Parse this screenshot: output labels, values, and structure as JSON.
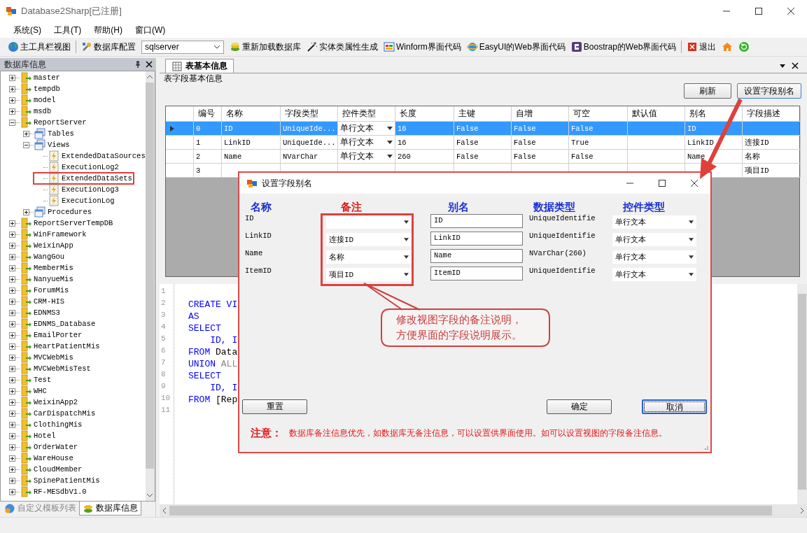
{
  "window": {
    "title": "Database2Sharp[已注册]"
  },
  "menu": [
    "系统(S)",
    "工具(T)",
    "帮助(H)",
    "窗口(W)"
  ],
  "toolbar": [
    {
      "kind": "button",
      "label": "主工具栏视图"
    },
    {
      "kind": "separator"
    },
    {
      "kind": "button",
      "label": "数据库配置"
    },
    {
      "kind": "combo",
      "value": "sqlserver"
    },
    {
      "kind": "button",
      "label": "重新加载数据库"
    },
    {
      "kind": "button",
      "label": "实体类属性生成"
    },
    {
      "kind": "button",
      "label": "Winform界面代码"
    },
    {
      "kind": "button",
      "label": "EasyUI的Web界面代码"
    },
    {
      "kind": "button",
      "label": "Boostrap的Web界面代码"
    },
    {
      "kind": "separator"
    },
    {
      "kind": "button",
      "label": "退出"
    },
    {
      "kind": "icon"
    },
    {
      "kind": "icon"
    }
  ],
  "tree": {
    "title": "数据库信息",
    "items": [
      {
        "label": "master",
        "kind": "database",
        "expanded": false
      },
      {
        "label": "tempdb",
        "kind": "database",
        "expanded": false
      },
      {
        "label": "model",
        "kind": "database",
        "expanded": false
      },
      {
        "label": "msdb",
        "kind": "database",
        "expanded": false
      },
      {
        "label": "ReportServer",
        "kind": "database",
        "expanded": true,
        "children": [
          {
            "label": "Tables",
            "kind": "folder",
            "expanded": false
          },
          {
            "label": "Views",
            "kind": "folder",
            "expanded": true,
            "children": [
              {
                "label": "ExtendedDataSources",
                "kind": "view",
                "marked": false
              },
              {
                "label": "ExecutionLog2",
                "kind": "view",
                "marked": false
              },
              {
                "label": "ExtendedDataSets",
                "kind": "view",
                "marked": true
              },
              {
                "label": "ExecutionLog3",
                "kind": "view",
                "marked": false
              },
              {
                "label": "ExecutionLog",
                "kind": "view",
                "marked": false
              }
            ]
          },
          {
            "label": "Procedures",
            "kind": "folder",
            "expanded": false
          }
        ]
      },
      {
        "label": "ReportServerTempDB",
        "kind": "database",
        "expanded": false
      },
      {
        "label": "WinFramework",
        "kind": "database",
        "expanded": false
      },
      {
        "label": "WeixinApp",
        "kind": "database",
        "expanded": false
      },
      {
        "label": "WangGou",
        "kind": "database",
        "expanded": false
      },
      {
        "label": "MemberMis",
        "kind": "database",
        "expanded": false
      },
      {
        "label": "NanyueMis",
        "kind": "database",
        "expanded": false
      },
      {
        "label": "ForumMis",
        "kind": "database",
        "expanded": false
      },
      {
        "label": "CRM-HIS",
        "kind": "database",
        "expanded": false
      },
      {
        "label": "EDNMS3",
        "kind": "database",
        "expanded": false
      },
      {
        "label": "EDNMS_Database",
        "kind": "database",
        "expanded": false
      },
      {
        "label": "EmailPorter",
        "kind": "database",
        "expanded": false
      },
      {
        "label": "HeartPatientMis",
        "kind": "database",
        "expanded": false
      },
      {
        "label": "MVCWebMis",
        "kind": "database",
        "expanded": false
      },
      {
        "label": "MVCWebMisTest",
        "kind": "database",
        "expanded": false
      },
      {
        "label": "Test",
        "kind": "database",
        "expanded": false
      },
      {
        "label": "WHC",
        "kind": "database",
        "expanded": false
      },
      {
        "label": "WeixinApp2",
        "kind": "database",
        "expanded": false
      },
      {
        "label": "CarDispatchMis",
        "kind": "database",
        "expanded": false
      },
      {
        "label": "ClothingMis",
        "kind": "database",
        "expanded": false
      },
      {
        "label": "Hotel",
        "kind": "database",
        "expanded": false
      },
      {
        "label": "OrderWater",
        "kind": "database",
        "expanded": false
      },
      {
        "label": "WareHouse",
        "kind": "database",
        "expanded": false
      },
      {
        "label": "CloudMember",
        "kind": "database",
        "expanded": false
      },
      {
        "label": "SpinePatientMis",
        "kind": "database",
        "expanded": false
      },
      {
        "label": "RF-MESdbV1.0",
        "kind": "database",
        "expanded": false
      }
    ]
  },
  "panel_tabs": [
    {
      "label": "自定义模板列表",
      "selected": false
    },
    {
      "label": "数据库信息",
      "selected": true
    }
  ],
  "document_tab": {
    "label": "表基本信息"
  },
  "section_label": "表字段基本信息",
  "buttons": [
    "刷新",
    "设置字段别名"
  ],
  "table": {
    "columns": [
      {
        "label": "编号",
        "kind": "text"
      },
      {
        "label": "名称",
        "kind": "text"
      },
      {
        "label": "字段类型",
        "kind": "text"
      },
      {
        "label": "控件类型",
        "kind": "combo"
      },
      {
        "label": "长度",
        "kind": "text"
      },
      {
        "label": "主键",
        "kind": "text"
      },
      {
        "label": "自增",
        "kind": "text"
      },
      {
        "label": "可空",
        "kind": "text"
      },
      {
        "label": "默认值",
        "kind": "text"
      },
      {
        "label": "别名",
        "kind": "text"
      },
      {
        "label": "字段描述",
        "kind": "text"
      }
    ],
    "rows": [
      {
        "selected": true,
        "cells": [
          "0",
          "ID",
          "UniqueIde...",
          "单行文本",
          "16",
          "False",
          "False",
          "False",
          null,
          "ID",
          null
        ]
      },
      {
        "selected": false,
        "cells": [
          "1",
          "LinkID",
          "UniqueIde...",
          "单行文本",
          "16",
          "False",
          "False",
          "True",
          null,
          "LinkID",
          "连接ID"
        ]
      },
      {
        "selected": false,
        "cells": [
          "2",
          "Name",
          "NVarChar",
          "单行文本",
          "260",
          "False",
          "False",
          "False",
          null,
          "Name",
          "名称"
        ]
      },
      {
        "selected": false,
        "cells": [
          "3",
          null,
          null,
          null,
          null,
          null,
          null,
          null,
          null,
          null,
          "项目ID"
        ]
      }
    ]
  },
  "editor": {
    "lines": [
      {
        "number": "1"
      },
      {
        "number": "2",
        "tokens": [
          {
            "text": "CREATE VI",
            "kind": "keyword"
          }
        ]
      },
      {
        "number": "3",
        "tokens": [
          {
            "text": "AS",
            "kind": "keyword"
          }
        ]
      },
      {
        "number": "4",
        "tokens": [
          {
            "text": "SELECT",
            "kind": "keyword"
          }
        ]
      },
      {
        "number": "5",
        "tokens": [
          {
            "text": "    ID, I",
            "kind": "keyword"
          }
        ]
      },
      {
        "number": "6",
        "tokens": [
          {
            "text": "FROM",
            "kind": "keyword"
          },
          {
            "text": " Data",
            "kind": "plain"
          }
        ]
      },
      {
        "number": "7",
        "tokens": [
          {
            "text": "UNION",
            "kind": "keyword"
          },
          {
            "text": " ALL",
            "kind": "muted"
          }
        ]
      },
      {
        "number": "8",
        "tokens": [
          {
            "text": "SELECT",
            "kind": "keyword"
          }
        ]
      },
      {
        "number": "9",
        "tokens": [
          {
            "text": "    ID, I",
            "kind": "keyword"
          }
        ]
      },
      {
        "number": "10",
        "tokens": [
          {
            "text": "FROM",
            "kind": "keyword"
          },
          {
            "text": " [Rep",
            "kind": "plain"
          }
        ]
      },
      {
        "number": "11"
      }
    ]
  },
  "dialog": {
    "title": "设置字段别名",
    "columns": [
      {
        "label": "名称",
        "color": "#1a2fd0"
      },
      {
        "label": "备注",
        "color": "#e01818"
      },
      {
        "label": "别名",
        "color": "#1a2fd0"
      },
      {
        "label": "数据类型",
        "color": "#1a2fd0"
      },
      {
        "label": "控件类型",
        "color": "#1a2fd0"
      }
    ],
    "rows": [
      {
        "name": "ID",
        "alias": "ID",
        "data_type": "UniqueIdentifie",
        "control": "单行文本"
      },
      {
        "name": "LinkID",
        "remark": "连接ID",
        "alias": "LinkID",
        "data_type": "UniqueIdentifie",
        "control": "单行文本"
      },
      {
        "name": "Name",
        "remark": "名称",
        "alias": "Name",
        "data_type": "NVarChar(260)",
        "control": "单行文本"
      },
      {
        "name": "ItemID",
        "remark": "项目ID",
        "alias": "ItemID",
        "data_type": "UniqueIdentifie",
        "control": "单行文本"
      }
    ],
    "buttons": [
      {
        "label": "重置",
        "focused": false
      },
      {
        "label": "确定",
        "focused": false
      },
      {
        "label": "取消",
        "focused": true
      }
    ],
    "note": {
      "label": "注意：",
      "text": "数据库备注信息优先，如数据库无备注信息，可以设置供界面使用。如可以设置视图的字段备注信息。"
    }
  },
  "callout": {
    "lines": [
      "修改视图字段的备注说明，",
      "方便界面的字段说明展示。"
    ]
  }
}
